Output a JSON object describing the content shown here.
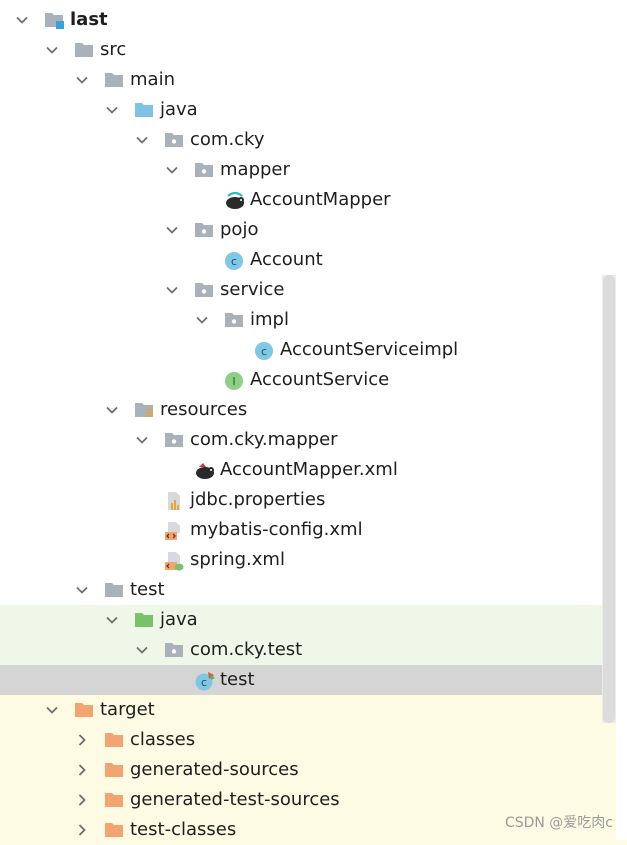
{
  "colors": {
    "folder": "#a9b1ba",
    "folder_package": "#a9b1ba",
    "folder_source": "#7ec3e6",
    "folder_test": "#79c26a",
    "folder_target": "#f2a471",
    "class_icon": "#7ec8e6",
    "interface_icon": "#8ecf88",
    "selected_row": "#d5d5d5",
    "test_row_bg": "#eef7e8",
    "target_row_bg": "#fdfbe3"
  },
  "tree": [
    {
      "label": "last",
      "depth": 0,
      "expanded": true,
      "icon": "module-folder-icon",
      "bold": true
    },
    {
      "label": "src",
      "depth": 1,
      "expanded": true,
      "icon": "folder-icon"
    },
    {
      "label": "main",
      "depth": 2,
      "expanded": true,
      "icon": "folder-icon"
    },
    {
      "label": "java",
      "depth": 3,
      "expanded": true,
      "icon": "source-folder-icon"
    },
    {
      "label": "com.cky",
      "depth": 4,
      "expanded": true,
      "icon": "package-icon"
    },
    {
      "label": "mapper",
      "depth": 5,
      "expanded": true,
      "icon": "package-icon"
    },
    {
      "label": "AccountMapper",
      "depth": 6,
      "icon": "mybatis-mapper-icon"
    },
    {
      "label": "pojo",
      "depth": 5,
      "expanded": true,
      "icon": "package-icon"
    },
    {
      "label": "Account",
      "depth": 6,
      "icon": "class-icon"
    },
    {
      "label": "service",
      "depth": 5,
      "expanded": true,
      "icon": "package-icon"
    },
    {
      "label": "impl",
      "depth": 6,
      "expanded": true,
      "icon": "package-icon"
    },
    {
      "label": "AccountServiceimpl",
      "depth": 7,
      "icon": "class-icon"
    },
    {
      "label": "AccountService",
      "depth": 6,
      "icon": "interface-icon"
    },
    {
      "label": "resources",
      "depth": 3,
      "expanded": true,
      "icon": "resources-folder-icon"
    },
    {
      "label": "com.cky.mapper",
      "depth": 4,
      "expanded": true,
      "icon": "package-icon"
    },
    {
      "label": "AccountMapper.xml",
      "depth": 5,
      "icon": "mybatis-xml-icon"
    },
    {
      "label": "jdbc.properties",
      "depth": 4,
      "icon": "properties-file-icon"
    },
    {
      "label": "mybatis-config.xml",
      "depth": 4,
      "icon": "xml-file-icon"
    },
    {
      "label": "spring.xml",
      "depth": 4,
      "icon": "spring-xml-icon"
    },
    {
      "label": "test",
      "depth": 2,
      "expanded": true,
      "icon": "folder-icon"
    },
    {
      "label": "java",
      "depth": 3,
      "expanded": true,
      "icon": "test-source-folder-icon",
      "bg": "test"
    },
    {
      "label": "com.cky.test",
      "depth": 4,
      "expanded": true,
      "icon": "package-icon",
      "bg": "test"
    },
    {
      "label": "test",
      "depth": 5,
      "icon": "test-class-icon",
      "selected": true
    },
    {
      "label": "target",
      "depth": 1,
      "expanded": true,
      "icon": "target-folder-icon",
      "bg": "target"
    },
    {
      "label": "classes",
      "depth": 2,
      "expanded": false,
      "icon": "target-folder-icon",
      "bg": "target"
    },
    {
      "label": "generated-sources",
      "depth": 2,
      "expanded": false,
      "icon": "target-folder-icon",
      "bg": "target"
    },
    {
      "label": "generated-test-sources",
      "depth": 2,
      "expanded": false,
      "icon": "target-folder-icon",
      "bg": "target"
    },
    {
      "label": "test-classes",
      "depth": 2,
      "expanded": false,
      "icon": "target-folder-icon",
      "bg": "target"
    }
  ],
  "watermark": "CSDN @爱吃肉c"
}
